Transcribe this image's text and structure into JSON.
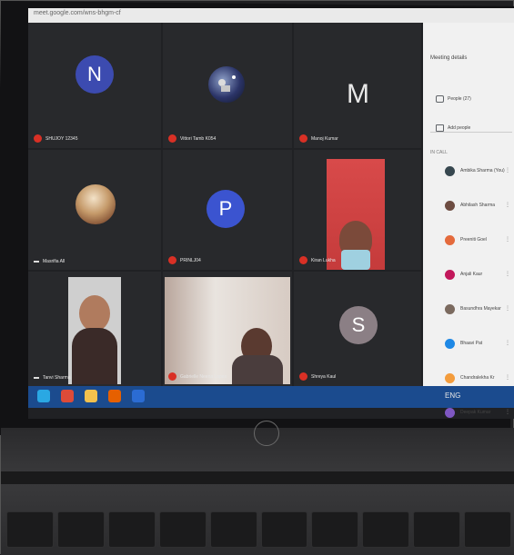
{
  "browser": {
    "address_text": "meet.google.com/wns-bhgm-cf"
  },
  "meeting": {
    "tiles": [
      {
        "label": "SHUJOY 12345",
        "kind": "avatar",
        "letter": "N",
        "avatar_color": "#3c4bb0"
      },
      {
        "label": "Vittori Tamb K054",
        "kind": "image-avatar"
      },
      {
        "label": "Manoj Kumar",
        "kind": "letter",
        "letter": "M"
      },
      {
        "label": "Masrifia All",
        "kind": "image-avatar"
      },
      {
        "label": "PRINLJ04",
        "kind": "avatar",
        "letter": "P",
        "avatar_color": "#3b54d0"
      },
      {
        "label": "Kiran Lukha",
        "kind": "video"
      },
      {
        "label": "Tanvi Sharma",
        "kind": "video"
      },
      {
        "label": "Gabrielle Neena Lopes",
        "kind": "video"
      },
      {
        "label": "Shreya Kaul",
        "kind": "avatar",
        "letter": "S",
        "avatar_color": "#8b7f85"
      }
    ]
  },
  "panel": {
    "title": "Meeting details",
    "people_tab": "People (27)",
    "chat_tab": "Add people",
    "section_label": "IN CALL",
    "participants": [
      {
        "name": "Ambika Sharma (You)",
        "color": "#37474f"
      },
      {
        "name": "Abhilash Sharma",
        "color": "#6d4c41"
      },
      {
        "name": "Preeniti Goel",
        "color": "#e46a3c"
      },
      {
        "name": "Anjali Kaur",
        "color": "#c2185b"
      },
      {
        "name": "Basundhra Mayekar",
        "color": "#7b6a5f"
      },
      {
        "name": "Bhaavi Pat",
        "color": "#1e88e5"
      },
      {
        "name": "Chandralekha Kr",
        "color": "#f39c3c"
      },
      {
        "name": "Deepak Kumar",
        "color": "#7e57c2"
      }
    ]
  },
  "taskbar": {
    "icons": [
      {
        "name": "edge",
        "color": "#2aa8e3"
      },
      {
        "name": "chrome",
        "color": "#dd4b39"
      },
      {
        "name": "file-explorer",
        "color": "#f2c14e"
      },
      {
        "name": "firefox",
        "color": "#e66000"
      },
      {
        "name": "powerpoint",
        "color": "#2b6cd3"
      }
    ],
    "tray_text": "ENG"
  }
}
